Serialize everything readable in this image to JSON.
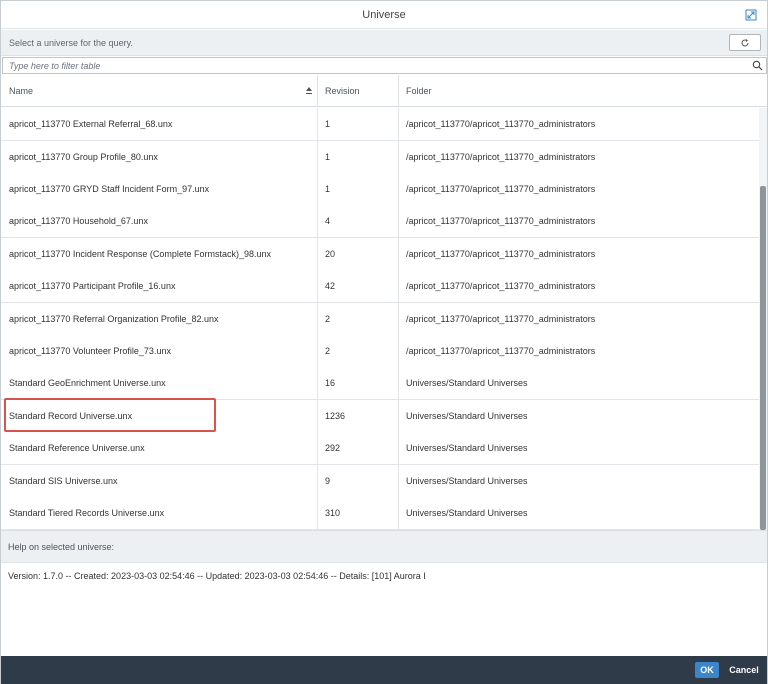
{
  "window": {
    "title": "Universe"
  },
  "subbar": {
    "prompt": "Select a universe for the query."
  },
  "filter": {
    "placeholder": "Type here to filter table"
  },
  "table": {
    "columns": [
      "Name",
      "Revision",
      "Folder"
    ],
    "sort_column": "Name",
    "rows": [
      {
        "name": "apricot_113770 External Referral_68.unx",
        "revision": "1",
        "folder": "/apricot_113770/apricot_113770_administrators"
      },
      {
        "name": "apricot_113770 Group Profile_80.unx",
        "revision": "1",
        "folder": "/apricot_113770/apricot_113770_administrators"
      },
      {
        "name": "apricot_113770 GRYD Staff Incident Form_97.unx",
        "revision": "1",
        "folder": "/apricot_113770/apricot_113770_administrators"
      },
      {
        "name": "apricot_113770 Household_67.unx",
        "revision": "4",
        "folder": "/apricot_113770/apricot_113770_administrators"
      },
      {
        "name": "apricot_113770 Incident Response (Complete Formstack)_98.unx",
        "revision": "20",
        "folder": "/apricot_113770/apricot_113770_administrators"
      },
      {
        "name": "apricot_113770 Participant Profile_16.unx",
        "revision": "42",
        "folder": "/apricot_113770/apricot_113770_administrators"
      },
      {
        "name": "apricot_113770 Referral Organization Profile_82.unx",
        "revision": "2",
        "folder": "/apricot_113770/apricot_113770_administrators"
      },
      {
        "name": "apricot_113770 Volunteer Profile_73.unx",
        "revision": "2",
        "folder": "/apricot_113770/apricot_113770_administrators"
      },
      {
        "name": "Standard GeoEnrichment Universe.unx",
        "revision": "16",
        "folder": "Universes/Standard Universes"
      },
      {
        "name": "Standard Record Universe.unx",
        "revision": "1236",
        "folder": "Universes/Standard Universes"
      },
      {
        "name": "Standard Reference Universe.unx",
        "revision": "292",
        "folder": "Universes/Standard Universes"
      },
      {
        "name": "Standard SIS Universe.unx",
        "revision": "9",
        "folder": "Universes/Standard Universes"
      },
      {
        "name": "Standard Tiered Records Universe.unx",
        "revision": "310",
        "folder": "Universes/Standard Universes"
      }
    ],
    "highlighted_row": "Standard Record Universe.unx"
  },
  "help": {
    "label": "Help on selected universe:",
    "details": "Version: 1.7.0 -- Created: 2023-03-03 02:54:46 -- Updated: 2023-03-03 02:54:46 -- Details: [101] Aurora I"
  },
  "footer": {
    "ok_label": "OK",
    "cancel_label": "Cancel"
  },
  "colors": {
    "footer_bg": "#2f3b48",
    "ok_button": "#3a86c8",
    "highlight_border": "#d9534f",
    "subbar_bg": "#edf0f3"
  },
  "icons": {
    "expand": "expand-icon",
    "refresh": "refresh-icon",
    "search": "search-icon",
    "sort": "sort-ascending-icon"
  }
}
